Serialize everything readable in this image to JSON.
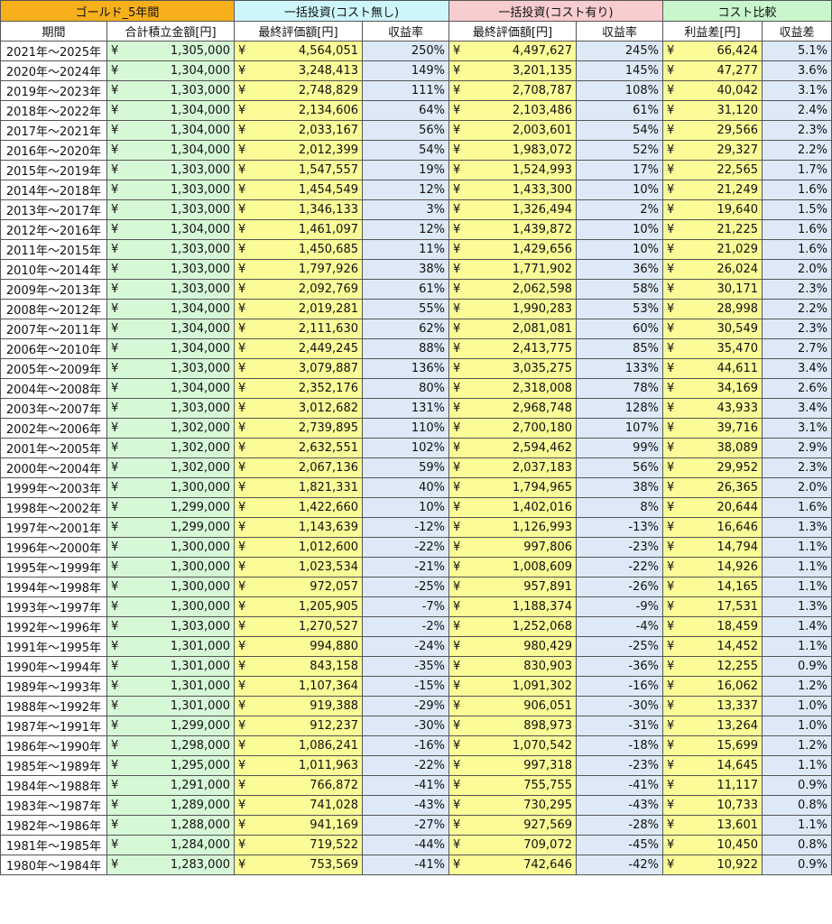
{
  "header_groups": [
    "ゴールド_5年間",
    "一括投資(コスト無し)",
    "一括投資(コスト有り)",
    "コスト比較"
  ],
  "column_headers": [
    "期間",
    "合計積立金額[円]",
    "最終評価額[円]",
    "収益率",
    "最終評価額[円]",
    "収益率",
    "利益差[円]",
    "収益差"
  ],
  "currency_symbol": "¥",
  "colors": {
    "gold_header": "#f7b01c",
    "no_cost_header": "#cdf6fb",
    "with_cost_header": "#f8cdd0",
    "compare_header": "#c9f6cd",
    "total_cell": "#d7f8d7",
    "value_cell": "#fbfb98",
    "rate_cell": "#dde9f6"
  },
  "rows": [
    [
      "2021年～2025年",
      "1,305,000",
      "4,564,051",
      "250%",
      "4,497,627",
      "245%",
      "66,424",
      "5.1%"
    ],
    [
      "2020年～2024年",
      "1,304,000",
      "3,248,413",
      "149%",
      "3,201,135",
      "145%",
      "47,277",
      "3.6%"
    ],
    [
      "2019年～2023年",
      "1,303,000",
      "2,748,829",
      "111%",
      "2,708,787",
      "108%",
      "40,042",
      "3.1%"
    ],
    [
      "2018年～2022年",
      "1,304,000",
      "2,134,606",
      "64%",
      "2,103,486",
      "61%",
      "31,120",
      "2.4%"
    ],
    [
      "2017年～2021年",
      "1,304,000",
      "2,033,167",
      "56%",
      "2,003,601",
      "54%",
      "29,566",
      "2.3%"
    ],
    [
      "2016年～2020年",
      "1,304,000",
      "2,012,399",
      "54%",
      "1,983,072",
      "52%",
      "29,327",
      "2.2%"
    ],
    [
      "2015年～2019年",
      "1,303,000",
      "1,547,557",
      "19%",
      "1,524,993",
      "17%",
      "22,565",
      "1.7%"
    ],
    [
      "2014年～2018年",
      "1,303,000",
      "1,454,549",
      "12%",
      "1,433,300",
      "10%",
      "21,249",
      "1.6%"
    ],
    [
      "2013年～2017年",
      "1,303,000",
      "1,346,133",
      "3%",
      "1,326,494",
      "2%",
      "19,640",
      "1.5%"
    ],
    [
      "2012年～2016年",
      "1,304,000",
      "1,461,097",
      "12%",
      "1,439,872",
      "10%",
      "21,225",
      "1.6%"
    ],
    [
      "2011年～2015年",
      "1,303,000",
      "1,450,685",
      "11%",
      "1,429,656",
      "10%",
      "21,029",
      "1.6%"
    ],
    [
      "2010年～2014年",
      "1,303,000",
      "1,797,926",
      "38%",
      "1,771,902",
      "36%",
      "26,024",
      "2.0%"
    ],
    [
      "2009年～2013年",
      "1,303,000",
      "2,092,769",
      "61%",
      "2,062,598",
      "58%",
      "30,171",
      "2.3%"
    ],
    [
      "2008年～2012年",
      "1,304,000",
      "2,019,281",
      "55%",
      "1,990,283",
      "53%",
      "28,998",
      "2.2%"
    ],
    [
      "2007年～2011年",
      "1,304,000",
      "2,111,630",
      "62%",
      "2,081,081",
      "60%",
      "30,549",
      "2.3%"
    ],
    [
      "2006年～2010年",
      "1,304,000",
      "2,449,245",
      "88%",
      "2,413,775",
      "85%",
      "35,470",
      "2.7%"
    ],
    [
      "2005年～2009年",
      "1,303,000",
      "3,079,887",
      "136%",
      "3,035,275",
      "133%",
      "44,611",
      "3.4%"
    ],
    [
      "2004年～2008年",
      "1,304,000",
      "2,352,176",
      "80%",
      "2,318,008",
      "78%",
      "34,169",
      "2.6%"
    ],
    [
      "2003年～2007年",
      "1,303,000",
      "3,012,682",
      "131%",
      "2,968,748",
      "128%",
      "43,933",
      "3.4%"
    ],
    [
      "2002年～2006年",
      "1,302,000",
      "2,739,895",
      "110%",
      "2,700,180",
      "107%",
      "39,716",
      "3.1%"
    ],
    [
      "2001年～2005年",
      "1,302,000",
      "2,632,551",
      "102%",
      "2,594,462",
      "99%",
      "38,089",
      "2.9%"
    ],
    [
      "2000年～2004年",
      "1,302,000",
      "2,067,136",
      "59%",
      "2,037,183",
      "56%",
      "29,952",
      "2.3%"
    ],
    [
      "1999年～2003年",
      "1,300,000",
      "1,821,331",
      "40%",
      "1,794,965",
      "38%",
      "26,365",
      "2.0%"
    ],
    [
      "1998年～2002年",
      "1,299,000",
      "1,422,660",
      "10%",
      "1,402,016",
      "8%",
      "20,644",
      "1.6%"
    ],
    [
      "1997年～2001年",
      "1,299,000",
      "1,143,639",
      "-12%",
      "1,126,993",
      "-13%",
      "16,646",
      "1.3%"
    ],
    [
      "1996年～2000年",
      "1,300,000",
      "1,012,600",
      "-22%",
      "997,806",
      "-23%",
      "14,794",
      "1.1%"
    ],
    [
      "1995年～1999年",
      "1,300,000",
      "1,023,534",
      "-21%",
      "1,008,609",
      "-22%",
      "14,926",
      "1.1%"
    ],
    [
      "1994年～1998年",
      "1,300,000",
      "972,057",
      "-25%",
      "957,891",
      "-26%",
      "14,165",
      "1.1%"
    ],
    [
      "1993年～1997年",
      "1,300,000",
      "1,205,905",
      "-7%",
      "1,188,374",
      "-9%",
      "17,531",
      "1.3%"
    ],
    [
      "1992年～1996年",
      "1,303,000",
      "1,270,527",
      "-2%",
      "1,252,068",
      "-4%",
      "18,459",
      "1.4%"
    ],
    [
      "1991年～1995年",
      "1,301,000",
      "994,880",
      "-24%",
      "980,429",
      "-25%",
      "14,452",
      "1.1%"
    ],
    [
      "1990年～1994年",
      "1,301,000",
      "843,158",
      "-35%",
      "830,903",
      "-36%",
      "12,255",
      "0.9%"
    ],
    [
      "1989年～1993年",
      "1,301,000",
      "1,107,364",
      "-15%",
      "1,091,302",
      "-16%",
      "16,062",
      "1.2%"
    ],
    [
      "1988年～1992年",
      "1,301,000",
      "919,388",
      "-29%",
      "906,051",
      "-30%",
      "13,337",
      "1.0%"
    ],
    [
      "1987年～1991年",
      "1,299,000",
      "912,237",
      "-30%",
      "898,973",
      "-31%",
      "13,264",
      "1.0%"
    ],
    [
      "1986年～1990年",
      "1,298,000",
      "1,086,241",
      "-16%",
      "1,070,542",
      "-18%",
      "15,699",
      "1.2%"
    ],
    [
      "1985年～1989年",
      "1,295,000",
      "1,011,963",
      "-22%",
      "997,318",
      "-23%",
      "14,645",
      "1.1%"
    ],
    [
      "1984年～1988年",
      "1,291,000",
      "766,872",
      "-41%",
      "755,755",
      "-41%",
      "11,117",
      "0.9%"
    ],
    [
      "1983年～1987年",
      "1,289,000",
      "741,028",
      "-43%",
      "730,295",
      "-43%",
      "10,733",
      "0.8%"
    ],
    [
      "1982年～1986年",
      "1,288,000",
      "941,169",
      "-27%",
      "927,569",
      "-28%",
      "13,601",
      "1.1%"
    ],
    [
      "1981年～1985年",
      "1,284,000",
      "719,522",
      "-44%",
      "709,072",
      "-45%",
      "10,450",
      "0.8%"
    ],
    [
      "1980年～1984年",
      "1,283,000",
      "753,569",
      "-41%",
      "742,646",
      "-42%",
      "10,922",
      "0.9%"
    ]
  ]
}
